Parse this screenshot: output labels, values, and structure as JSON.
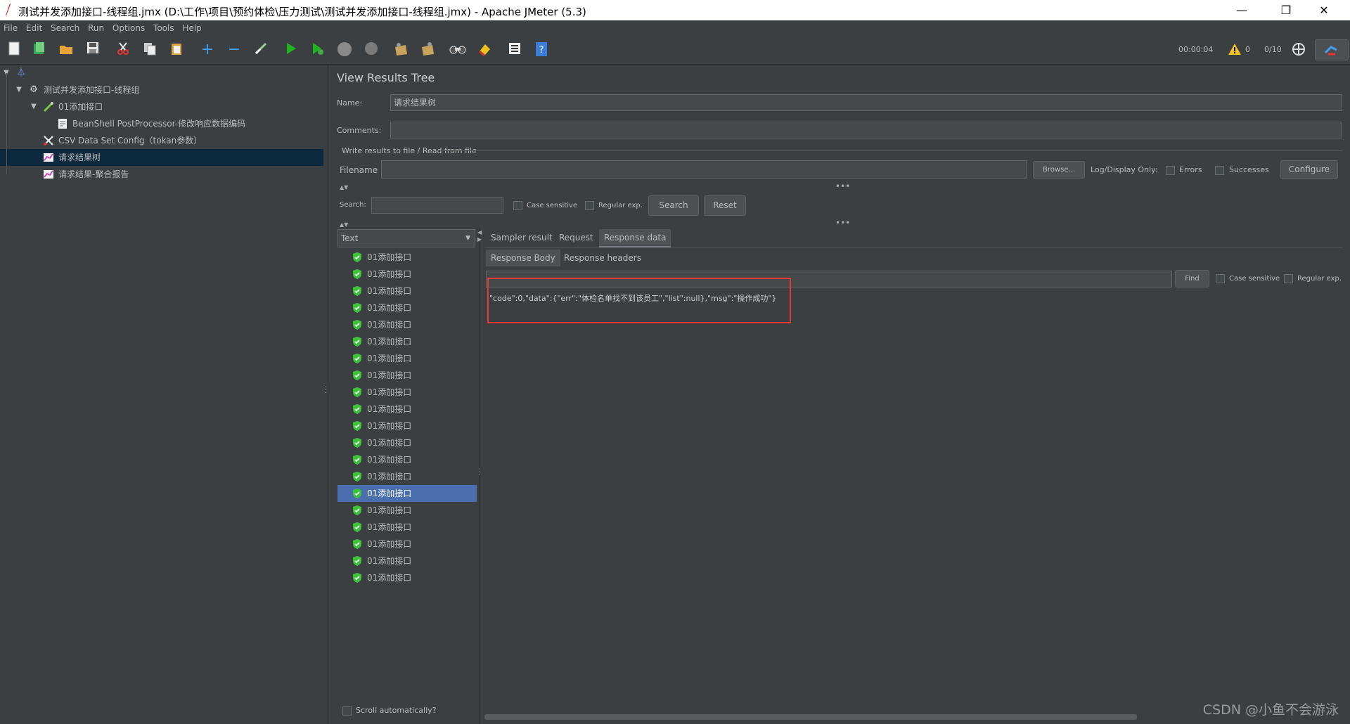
{
  "window": {
    "title": "测试并发添加接口-线程组.jmx (D:\\工作\\项目\\预约体检\\压力测试\\测试并发添加接口-线程组.jmx) - Apache JMeter (5.3)",
    "minimize": "—",
    "restore": "❐",
    "close": "✕"
  },
  "menu": [
    "File",
    "Edit",
    "Search",
    "Run",
    "Options",
    "Tools",
    "Help"
  ],
  "status": {
    "elapsed": "00:00:04",
    "warnings": "0",
    "threads": "0/10"
  },
  "tree": {
    "items": [
      {
        "label": "测试并发添加接口-线程组",
        "icon": "gear-icon"
      },
      {
        "label": "01添加接口",
        "icon": "pipette-icon"
      },
      {
        "label": "BeanShell PostProcessor-修改响应数据编码",
        "icon": "script-icon"
      },
      {
        "label": "CSV Data Set Config（tokan参数）",
        "icon": "scissors-icon"
      },
      {
        "label": "请求结果树",
        "icon": "chart-icon"
      },
      {
        "label": "请求结果-聚合报告",
        "icon": "chart-icon"
      }
    ]
  },
  "panel": {
    "title": "View Results Tree",
    "name_label": "Name:",
    "name_value": "请求结果树",
    "comments_label": "Comments:",
    "comments_value": "",
    "file_section": "Write results to file / Read from file",
    "filename_label": "Filename",
    "filename_value": "",
    "browse": "Browse...",
    "log_display": "Log/Display Only:",
    "errors": "Errors",
    "successes": "Successes",
    "configure": "Configure",
    "search_label": "Search:",
    "search_value": "",
    "case_sensitive": "Case sensitive",
    "regular_exp": "Regular exp.",
    "search_btn": "Search",
    "reset_btn": "Reset",
    "renderer": "Text",
    "scroll_auto": "Scroll automatically?"
  },
  "results": {
    "label": "01添加接口",
    "count": 20,
    "selected_index": 14
  },
  "tabs": [
    "Sampler result",
    "Request",
    "Response data"
  ],
  "subtabs": [
    "Response Body",
    "Response headers"
  ],
  "response": {
    "find_value": "",
    "find_btn": "Find",
    "case_sensitive": "Case sensitive",
    "regular_exp": "Regular exp.",
    "body": "\"code\":0,\"data\":{\"err\":\"体检名单找不到该员工\",\"list\":null},\"msg\":\"操作成功\"}"
  },
  "watermark": "CSDN @小鱼不会游泳",
  "colors": {
    "background": "#3c3f41",
    "selection": "#4b6eaf",
    "tree_selection": "#0d293e",
    "success": "#3cc33c",
    "highlight_box": "#e53935"
  }
}
